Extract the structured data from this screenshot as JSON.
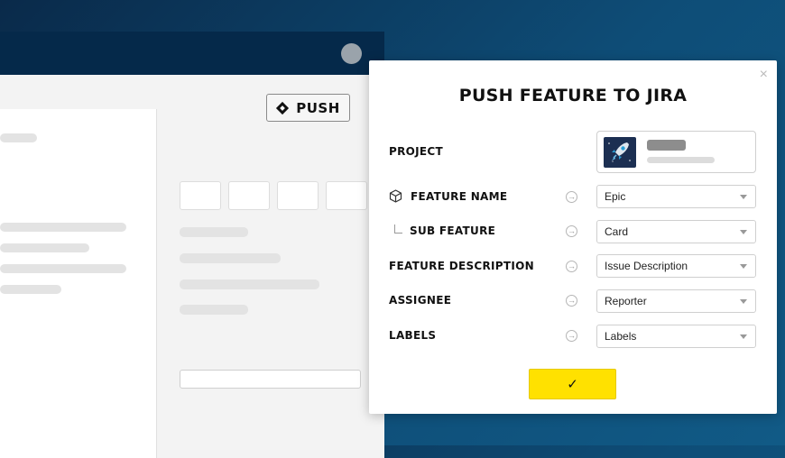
{
  "header_button": {
    "push_label": "PUSH"
  },
  "modal": {
    "title": "PUSH FEATURE TO JIRA",
    "close_symbol": "×",
    "project_label": "PROJECT",
    "rows": [
      {
        "label": "FEATURE NAME",
        "value": "Epic"
      },
      {
        "label": "SUB FEATURE",
        "value": "Card"
      },
      {
        "label": "FEATURE DESCRIPTION",
        "value": "Issue Description"
      },
      {
        "label": "ASSIGNEE",
        "value": "Reporter"
      },
      {
        "label": "LABELS",
        "value": "Labels"
      }
    ],
    "confirm_symbol": "✓",
    "icons": {
      "feature": "cube-icon",
      "sub_feature": "corner-branch-icon",
      "map_arrow": "arrow-right-circle-icon",
      "project": "rocket-icon"
    },
    "accent_color": "#ffe100"
  }
}
